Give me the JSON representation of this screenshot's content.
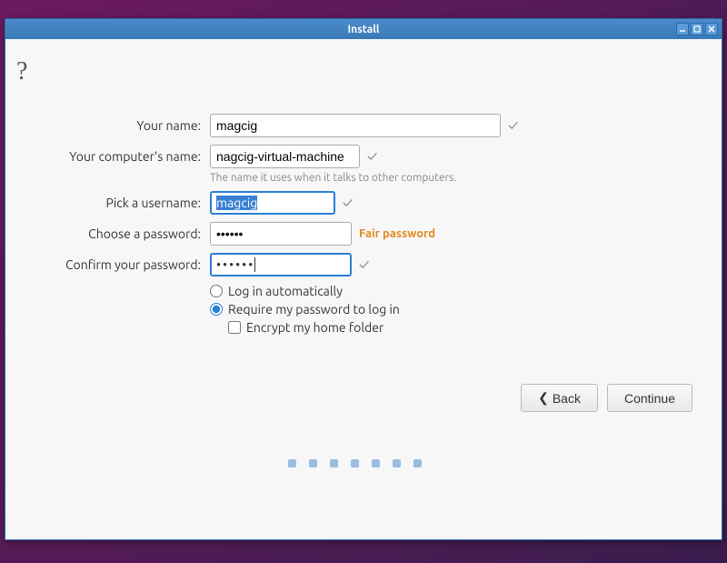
{
  "titlebar": {
    "title": "Install"
  },
  "header": {
    "help": "?"
  },
  "form": {
    "name": {
      "label": "Your name:",
      "value": "magcig"
    },
    "computer": {
      "label": "Your computer's name:",
      "value": "nagcig-virtual-machine",
      "hint": "The name it uses when it talks to other computers."
    },
    "username": {
      "label": "Pick a username:",
      "value": "magcig"
    },
    "password": {
      "label": "Choose a password:",
      "value": "••••••",
      "strength": "Fair password"
    },
    "confirm": {
      "label": "Confirm your password:",
      "value": "••••••"
    },
    "login": {
      "auto": "Log in automatically",
      "require": "Require my password to log in",
      "encrypt": "Encrypt my home folder"
    }
  },
  "buttons": {
    "back": "Back",
    "continue": "Continue"
  },
  "dots": 7
}
